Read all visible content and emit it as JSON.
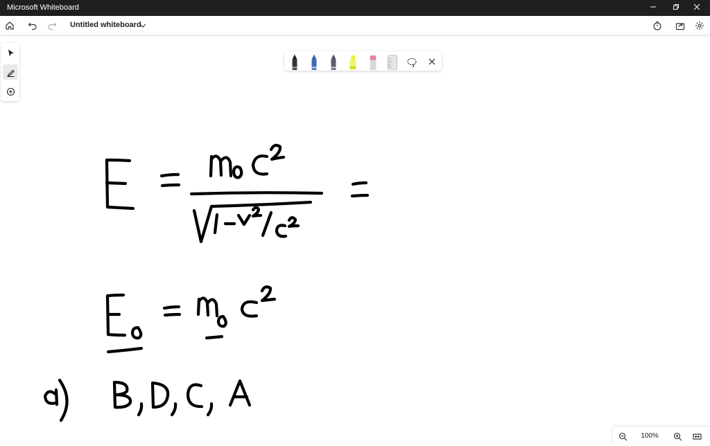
{
  "window": {
    "title": "Microsoft Whiteboard"
  },
  "appbar": {
    "board_title": "Untitled whiteboard"
  },
  "zoom": {
    "level": "100%"
  },
  "pens": [
    {
      "name": "black-pen",
      "color": "#1a1a1a"
    },
    {
      "name": "blue-pen",
      "color": "#2f5fa8"
    },
    {
      "name": "dark-pen",
      "color": "#4a4a5a"
    },
    {
      "name": "highlighter",
      "color": "#e8f040"
    },
    {
      "name": "eraser",
      "color": "#e48aa0"
    },
    {
      "name": "ruler",
      "color": "#bdbdbd"
    }
  ],
  "colors": {
    "titlebar": "#1f1f1f",
    "ink": "#000000",
    "selected_tool": "#e8e8e8"
  }
}
